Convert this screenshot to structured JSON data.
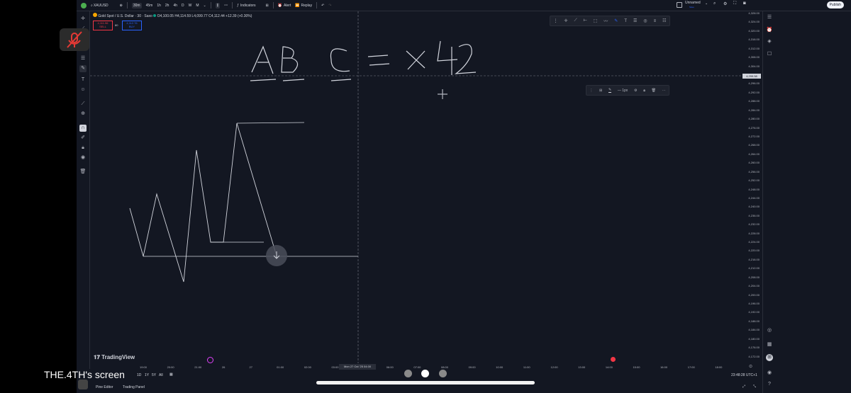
{
  "topbar": {
    "symbol": "XAUUSD",
    "timeframes": [
      "30m",
      "45m",
      "1h",
      "2h",
      "4h",
      "D",
      "W",
      "M"
    ],
    "active_timeframe": "30m",
    "indicators_label": "Indicators",
    "alert_label": "Alert",
    "replay_label": "Replay",
    "layout_name": "Unnamed",
    "layout_sub": "Save",
    "publish_label": "Publish"
  },
  "legend": {
    "title": "Gold Spot / U.S. Dollar · 30 · Saxo",
    "ohlc": "O4,100.05 H4,114.59 L4,099.77 C4,112.44 +12.39 (+0.30%)",
    "sell_price": "4,111.96",
    "sell_label": "SELL",
    "spread": "80",
    "buy_price": "4,112.76",
    "buy_label": "BUY"
  },
  "drawing_text": "ABC = x 42",
  "line_toolbar": {
    "width_label": "1px"
  },
  "price_axis": [
    "4,328.00",
    "4,324.00",
    "4,320.00",
    "4,316.00",
    "4,312.00",
    "4,308.00",
    "4,304.00",
    "4,300.00",
    "4,296.00",
    "4,292.00",
    "4,288.00",
    "4,284.00",
    "4,280.00",
    "4,276.00",
    "4,272.00",
    "4,268.00",
    "4,264.00",
    "4,260.00",
    "4,256.00",
    "4,252.00",
    "4,248.00",
    "4,244.00",
    "4,240.00",
    "4,236.00",
    "4,232.00",
    "4,228.00",
    "4,224.00",
    "4,220.00",
    "4,216.00",
    "4,212.00",
    "4,208.00",
    "4,204.00",
    "4,200.00",
    "4,196.00",
    "4,192.00",
    "4,188.00",
    "4,184.00",
    "4,180.00",
    "4,176.00",
    "4,172.00"
  ],
  "crosshair_price": "4,299.58",
  "time_axis": [
    "19:00",
    "20:00",
    "21:00",
    "26",
    "27",
    "01:00",
    "02:00",
    "03:00",
    "05:00",
    "06:00",
    "07:00",
    "08:00",
    "09:00",
    "10:00",
    "11:00",
    "12:00",
    "13:00",
    "14:00",
    "15:00",
    "16:00",
    "17:00",
    "18:00"
  ],
  "crosshair_date": "Mon 27 Oct '25  04:00",
  "bottom": {
    "ranges": [
      "1D",
      "1Y",
      "5Y",
      "All"
    ],
    "pine_editor": "Pine Editor",
    "trading_panel": "Trading Panel",
    "clock": "23:48:28 UTC+1"
  },
  "brand": "TradingView",
  "screen_label": "THE.4TH's screen",
  "colors": {
    "background": "#131722",
    "sell": "#f23645",
    "buy": "#2962ff",
    "drawing": "#d1d4dc"
  }
}
